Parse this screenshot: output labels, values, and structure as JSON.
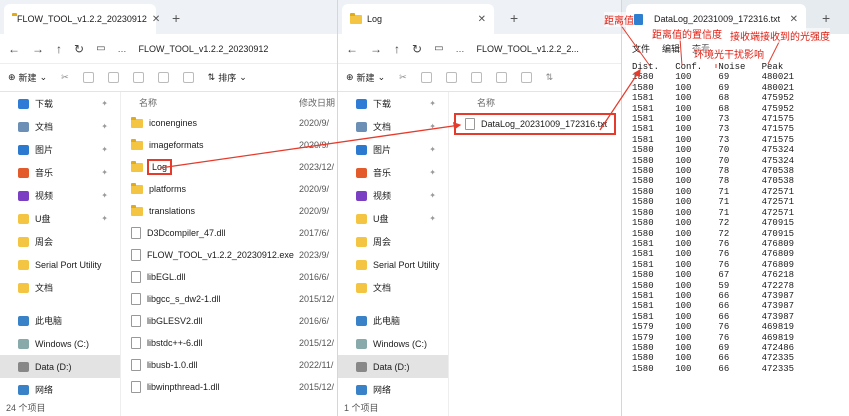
{
  "win1": {
    "tab": "FLOW_TOOL_v1.2.2_20230912",
    "path": "FLOW_TOOL_v1.2.2_20230912",
    "new": "新建",
    "sort": "排序",
    "side": [
      {
        "label": "下载",
        "c": "#2e7cd6",
        "pin": true
      },
      {
        "label": "文档",
        "c": "#6b8fb5",
        "pin": true
      },
      {
        "label": "图片",
        "c": "#2b7ad0",
        "pin": true
      },
      {
        "label": "音乐",
        "c": "#e35a2b",
        "pin": true
      },
      {
        "label": "视频",
        "c": "#7b3fc4",
        "pin": true
      },
      {
        "label": "U盘",
        "c": "#f4c542",
        "pin": true
      },
      {
        "label": "周会",
        "c": "#f4c542"
      },
      {
        "label": "Serial Port Utility",
        "c": "#f4c542"
      },
      {
        "label": "文档",
        "c": "#f4c542"
      },
      {
        "label": ""
      },
      {
        "label": "此电脑",
        "c": "#3a82c8"
      },
      {
        "label": "Windows (C:)",
        "c": "#8aa"
      },
      {
        "label": "Data (D:)",
        "c": "#888",
        "sel": true
      },
      {
        "label": "网络",
        "c": "#3a82c8"
      }
    ],
    "col_name": "名称",
    "col_date": "修改日期",
    "files": [
      {
        "n": "iconengines",
        "d": "2020/9/",
        "f": 1
      },
      {
        "n": "imageformats",
        "d": "2020/9/",
        "f": 1
      },
      {
        "n": "Log",
        "d": "2023/12/",
        "f": 1,
        "hl": 1
      },
      {
        "n": "platforms",
        "d": "2020/9/",
        "f": 1
      },
      {
        "n": "translations",
        "d": "2020/9/",
        "f": 1
      },
      {
        "n": "D3Dcompiler_47.dll",
        "d": "2017/6/"
      },
      {
        "n": "FLOW_TOOL_v1.2.2_20230912.exe",
        "d": "2023/9/"
      },
      {
        "n": "libEGL.dll",
        "d": "2016/6/"
      },
      {
        "n": "libgcc_s_dw2-1.dll",
        "d": "2015/12/"
      },
      {
        "n": "libGLESV2.dll",
        "d": "2016/6/"
      },
      {
        "n": "libstdc++-6.dll",
        "d": "2015/12/"
      },
      {
        "n": "libusb-1.0.dll",
        "d": "2022/11/"
      },
      {
        "n": "libwinpthread-1.dll",
        "d": "2015/12/"
      }
    ],
    "status": "24 个项目"
  },
  "win2": {
    "tab": "Log",
    "path": "FLOW_TOOL_v1.2.2_2...",
    "new": "新建",
    "side": [
      {
        "label": "下载",
        "c": "#2e7cd6",
        "pin": true
      },
      {
        "label": "文档",
        "c": "#6b8fb5",
        "pin": true
      },
      {
        "label": "图片",
        "c": "#2b7ad0",
        "pin": true
      },
      {
        "label": "音乐",
        "c": "#e35a2b",
        "pin": true
      },
      {
        "label": "视频",
        "c": "#7b3fc4",
        "pin": true
      },
      {
        "label": "U盘",
        "c": "#f4c542",
        "pin": true
      },
      {
        "label": "周会",
        "c": "#f4c542"
      },
      {
        "label": "Serial Port Utility",
        "c": "#f4c542"
      },
      {
        "label": "文档",
        "c": "#f4c542"
      },
      {
        "label": ""
      },
      {
        "label": "此电脑",
        "c": "#3a82c8"
      },
      {
        "label": "Windows (C:)",
        "c": "#8aa"
      },
      {
        "label": "Data (D:)",
        "c": "#888",
        "sel": true
      },
      {
        "label": "网络",
        "c": "#3a82c8"
      }
    ],
    "col_name": "名称",
    "file": "DataLog_20231009_172316.txt",
    "status": "1 个项目"
  },
  "win3": {
    "tab": "DataLog_20231009_172316.txt",
    "menu": [
      "文件",
      "编辑",
      "查看"
    ],
    "header": "Dist.   Conf.   Noise   Peak",
    "rows": [
      "1580    100     69      480021",
      "1580    100     69      480021",
      "1581    100     68      475952",
      "1581    100     68      475952",
      "1581    100     73      471575",
      "1581    100     73      471575",
      "1581    100     73      471575",
      "1580    100     70      475324",
      "1580    100     70      475324",
      "1580    100     78      470538",
      "1580    100     78      470538",
      "1580    100     71      472571",
      "1580    100     71      472571",
      "1580    100     71      472571",
      "1580    100     72      470915",
      "1580    100     72      470915",
      "1581    100     76      476809",
      "1581    100     76      476809",
      "1581    100     76      476809",
      "1580    100     67      476218",
      "1580    100     59      472278",
      "1581    100     66      473987",
      "1581    100     66      473987",
      "1581    100     66      473987",
      "1579    100     76      469819",
      "1579    100     76      469819",
      "1580    100     69      472486",
      "1580    100     66      472335",
      "1580    100     66      472335"
    ]
  },
  "annotations": {
    "dist": "距离值",
    "conf": "距离值的置信度",
    "noise": "环境光干扰影响",
    "peak": "接收端接收到的光强度"
  }
}
